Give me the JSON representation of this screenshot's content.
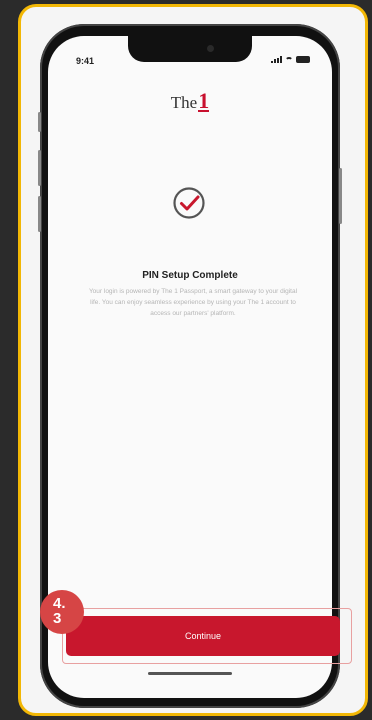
{
  "status_bar": {
    "time": "9:41"
  },
  "brand": {
    "name_prefix": "The",
    "name_suffix": "1"
  },
  "content": {
    "title": "PIN Setup Complete",
    "description": "Your login is powered by The 1 Passport, a smart gateway to your digital life. You can enjoy seamless experience by using your The 1 account to access our partners' platform."
  },
  "actions": {
    "continue_label": "Continue"
  },
  "annotation": {
    "step": "4.\n3"
  },
  "colors": {
    "accent": "#c8172d",
    "frame": "#f2b705",
    "badge": "#d64545"
  },
  "icons": {
    "success": "check-circle-icon"
  }
}
